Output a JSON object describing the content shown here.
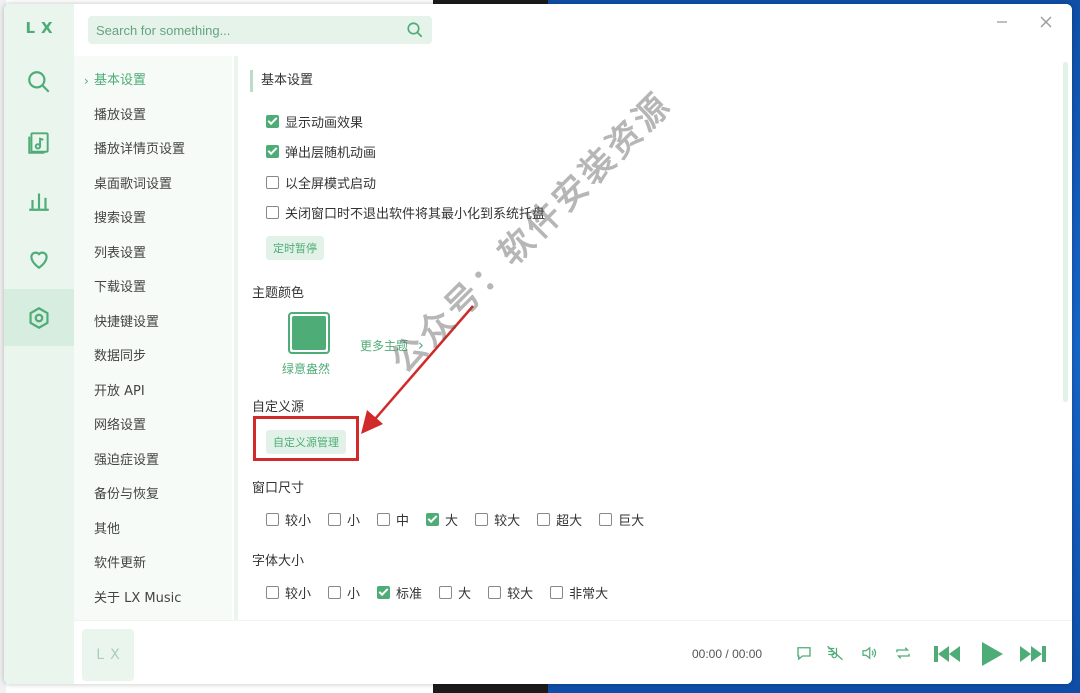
{
  "app": {
    "logo": "LX"
  },
  "search": {
    "placeholder": "Search for something..."
  },
  "nav": {
    "items": [
      {
        "label": "基本设置",
        "active": true
      },
      {
        "label": "播放设置"
      },
      {
        "label": "播放详情页设置"
      },
      {
        "label": "桌面歌词设置"
      },
      {
        "label": "搜索设置"
      },
      {
        "label": "列表设置"
      },
      {
        "label": "下载设置"
      },
      {
        "label": "快捷键设置"
      },
      {
        "label": "数据同步"
      },
      {
        "label": "开放 API"
      },
      {
        "label": "网络设置"
      },
      {
        "label": "强迫症设置"
      },
      {
        "label": "备份与恢复"
      },
      {
        "label": "其他"
      },
      {
        "label": "软件更新"
      },
      {
        "label": "关于 LX Music"
      }
    ]
  },
  "basic": {
    "title": "基本设置",
    "options": [
      {
        "label": "显示动画效果",
        "checked": true
      },
      {
        "label": "弹出层随机动画",
        "checked": true
      },
      {
        "label": "以全屏模式启动",
        "checked": false
      },
      {
        "label": "关闭窗口时不退出软件将其最小化到系统托盘",
        "checked": false
      }
    ],
    "timer_button": "定时暂停"
  },
  "theme": {
    "title": "主题颜色",
    "name": "绿意盎然",
    "color": "#4eac77",
    "more": "更多主题"
  },
  "custom_source": {
    "title": "自定义源",
    "button": "自定义源管理"
  },
  "window_size": {
    "title": "窗口尺寸",
    "options": [
      {
        "label": "较小",
        "checked": false
      },
      {
        "label": "小",
        "checked": false
      },
      {
        "label": "中",
        "checked": false
      },
      {
        "label": "大",
        "checked": true
      },
      {
        "label": "较大",
        "checked": false
      },
      {
        "label": "超大",
        "checked": false
      },
      {
        "label": "巨大",
        "checked": false
      }
    ]
  },
  "font_size": {
    "title": "字体大小",
    "options": [
      {
        "label": "较小",
        "checked": false
      },
      {
        "label": "小",
        "checked": false
      },
      {
        "label": "标准",
        "checked": true
      },
      {
        "label": "大",
        "checked": false
      },
      {
        "label": "较大",
        "checked": false
      },
      {
        "label": "非常大",
        "checked": false
      }
    ]
  },
  "player": {
    "cover_text": "LX",
    "current_time": "00:00",
    "separator": "/",
    "total_time": "00:00"
  },
  "watermark": "公众号：软件安装资源",
  "colors": {
    "accent": "#4eac77",
    "rail_bg": "#eaf5ee",
    "highlight": "#d12a2a"
  }
}
